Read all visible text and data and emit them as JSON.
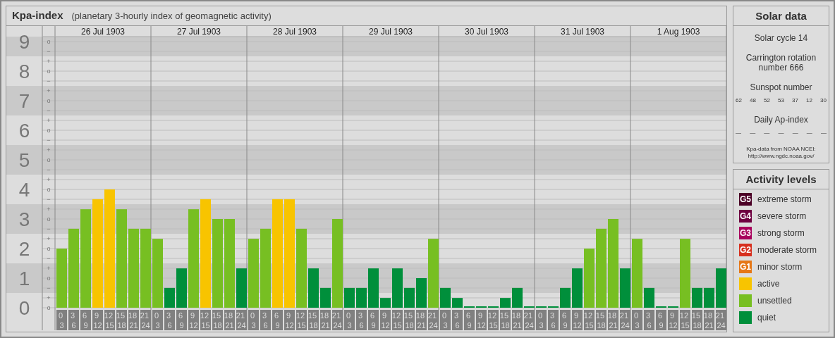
{
  "header": {
    "title": "Kpa-index",
    "subtitle": "(planetary 3-hourly index of geomagnetic activity)"
  },
  "chart": {
    "minor_ticks": [
      "o",
      "−",
      "+",
      "o",
      "−",
      "+",
      "o",
      "−",
      "+",
      "o",
      "−",
      "+",
      "o",
      "−",
      "+",
      "o",
      "−",
      "+",
      "o",
      "−",
      "+",
      "o",
      "−",
      "+",
      "o",
      "−",
      "+",
      "o"
    ],
    "days": [
      "26 Jul 1903",
      "27 Jul 1903",
      "28 Jul 1903",
      "29 Jul 1903",
      "30 Jul 1903",
      "31 Jul 1903",
      "1 Aug 1903"
    ],
    "chart_data": {
      "type": "bar",
      "grid": true,
      "ylim": [
        0,
        9.1667
      ],
      "yticks": [
        0,
        1,
        2,
        3,
        4,
        5,
        6,
        7,
        8,
        9
      ],
      "categories": [
        "0 3",
        "3 6",
        "6 9",
        "9 12",
        "12 15",
        "15 18",
        "18 21",
        "21 24",
        "0 3",
        "3 6",
        "6 9",
        "9 12",
        "12 15",
        "15 18",
        "18 21",
        "21 24",
        "0 3",
        "3 6",
        "6 9",
        "9 12",
        "12 15",
        "15 18",
        "18 21",
        "21 24",
        "0 3",
        "3 6",
        "6 9",
        "9 12",
        "12 15",
        "15 18",
        "18 21",
        "21 24",
        "0 3",
        "3 6",
        "6 9",
        "9 12",
        "12 15",
        "15 18",
        "18 21",
        "21 24",
        "0 3",
        "3 6",
        "6 9",
        "9 12",
        "12 15",
        "15 18",
        "18 21",
        "21 24",
        "0 3",
        "3 6",
        "6 9",
        "9 12",
        "12 15",
        "15 18",
        "18 21",
        "21 24"
      ],
      "series": [
        {
          "name": "quiet",
          "color": "#008f3b",
          "values": [
            null,
            null,
            null,
            null,
            null,
            null,
            null,
            null,
            null,
            0.67,
            1.33,
            null,
            null,
            null,
            null,
            1.33,
            null,
            null,
            null,
            null,
            null,
            1.33,
            0.67,
            null,
            0.67,
            0.67,
            1.33,
            0.33,
            1.33,
            0.67,
            1,
            null,
            0.67,
            0.33,
            0,
            0,
            0,
            0.33,
            0.67,
            0,
            0,
            0,
            0.67,
            1.33,
            null,
            null,
            null,
            1.33,
            null,
            0.67,
            0,
            0,
            null,
            0.67,
            0.67,
            1.33
          ]
        },
        {
          "name": "unsettled",
          "color": "#77bf22",
          "values": [
            2,
            2.67,
            3.33,
            null,
            null,
            3.33,
            2.67,
            2.67,
            2.33,
            null,
            null,
            3.33,
            null,
            3,
            3,
            null,
            2.33,
            2.67,
            null,
            null,
            2.67,
            null,
            null,
            3,
            null,
            null,
            null,
            null,
            null,
            null,
            null,
            2.33,
            null,
            null,
            null,
            null,
            null,
            null,
            null,
            null,
            null,
            null,
            null,
            null,
            2,
            2.67,
            3,
            null,
            2.33,
            null,
            null,
            null,
            2.33,
            null,
            null,
            null
          ]
        },
        {
          "name": "active",
          "color": "#f8c400",
          "values": [
            null,
            null,
            null,
            3.67,
            4,
            null,
            null,
            null,
            null,
            null,
            null,
            null,
            3.67,
            null,
            null,
            null,
            null,
            null,
            3.67,
            3.67,
            null,
            null,
            null,
            null,
            null,
            null,
            null,
            null,
            null,
            null,
            null,
            null,
            null,
            null,
            null,
            null,
            null,
            null,
            null,
            null,
            null,
            null,
            null,
            null,
            null,
            null,
            null,
            null,
            null,
            null,
            null,
            null,
            null,
            null,
            null,
            null
          ]
        }
      ]
    }
  },
  "solar": {
    "title": "Solar data",
    "cycle": "Solar cycle 14",
    "rotation": "Carrington rotation number 666",
    "sunspot_label": "Sunspot number",
    "sunspots": [
      "62",
      "48",
      "52",
      "53",
      "37",
      "12",
      "30"
    ],
    "ap_label": "Daily Ap-index",
    "ap_values": [
      "—",
      "—",
      "—",
      "—",
      "—",
      "—",
      "—"
    ],
    "source": "Kpa-data from NOAA NCEI:",
    "source_url": "http://www.ngdc.noaa.gov/"
  },
  "legend": {
    "title": "Activity levels",
    "items": [
      {
        "badge": "G5",
        "label": "extreme storm",
        "color": "#4b0026"
      },
      {
        "badge": "G4",
        "label": "severe storm",
        "color": "#6e0040"
      },
      {
        "badge": "G3",
        "label": "strong storm",
        "color": "#a8005c"
      },
      {
        "badge": "G2",
        "label": "moderate storm",
        "color": "#d7301f"
      },
      {
        "badge": "G1",
        "label": "minor storm",
        "color": "#e67817"
      }
    ]
  }
}
